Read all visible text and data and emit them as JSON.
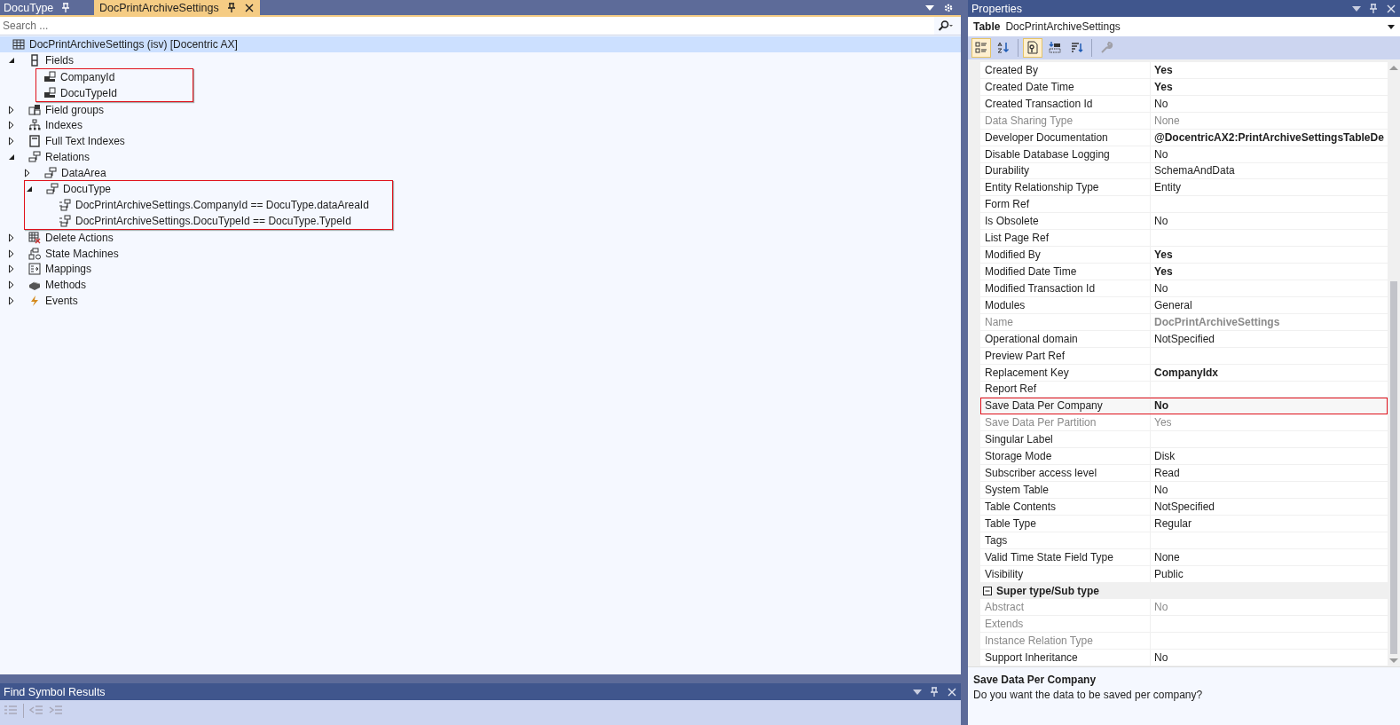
{
  "tabs": [
    {
      "label": "DocuType",
      "selected": false
    },
    {
      "label": "DocPrintArchiveSettings",
      "selected": true
    }
  ],
  "search": {
    "placeholder": "Search ..."
  },
  "tree": {
    "label": "DocPrintArchiveSettings (isv) [Docentric AX]",
    "kind": "table",
    "children": [
      {
        "label": "Fields",
        "kind": "fields",
        "expanded": true,
        "children_boxed": true,
        "children": [
          {
            "label": "CompanyId",
            "kind": "field"
          },
          {
            "label": "DocuTypeId",
            "kind": "field"
          }
        ]
      },
      {
        "label": "Field groups",
        "kind": "fieldgroup",
        "expanded": false
      },
      {
        "label": "Indexes",
        "kind": "index",
        "expanded": false
      },
      {
        "label": "Full Text Indexes",
        "kind": "fulltext",
        "expanded": false
      },
      {
        "label": "Relations",
        "kind": "relation",
        "expanded": true,
        "children": [
          {
            "label": "DataArea",
            "kind": "relation",
            "expanded": false
          },
          {
            "label": "DocuType",
            "kind": "relation",
            "expanded": true,
            "boxed": true,
            "children": [
              {
                "label": "DocPrintArchiveSettings.CompanyId == DocuType.dataAreaId",
                "kind": "constraint"
              },
              {
                "label": "DocPrintArchiveSettings.DocuTypeId == DocuType.TypeId",
                "kind": "constraint"
              }
            ]
          }
        ]
      },
      {
        "label": "Delete Actions",
        "kind": "delete",
        "expanded": false
      },
      {
        "label": "State Machines",
        "kind": "state",
        "expanded": false
      },
      {
        "label": "Mappings",
        "kind": "mapping",
        "expanded": false
      },
      {
        "label": "Methods",
        "kind": "method",
        "expanded": false
      },
      {
        "label": "Events",
        "kind": "event",
        "expanded": false
      }
    ]
  },
  "properties": {
    "title": "Properties",
    "object_type": "Table",
    "object_name": "DocPrintArchiveSettings",
    "toolbar": [
      {
        "kind": "categorized",
        "selected": true
      },
      {
        "kind": "alphabetical",
        "selected": false
      },
      {
        "kind": "properties",
        "selected": true
      },
      {
        "kind": "events",
        "selected": false
      },
      {
        "kind": "sort",
        "selected": false
      },
      {
        "kind": "wrench",
        "selected": false
      }
    ],
    "rows": [
      {
        "kind": "property",
        "name": "Created By",
        "value": "Yes",
        "bold": true,
        "disabled": false
      },
      {
        "kind": "property",
        "name": "Created Date Time",
        "value": "Yes",
        "bold": true,
        "disabled": false
      },
      {
        "kind": "property",
        "name": "Created Transaction Id",
        "value": "No",
        "bold": false,
        "disabled": false
      },
      {
        "kind": "property",
        "name": "Data Sharing Type",
        "value": "None",
        "bold": false,
        "disabled": true
      },
      {
        "kind": "property",
        "name": "Developer Documentation",
        "value": "@DocentricAX2:PrintArchiveSettingsTableDe",
        "bold": true,
        "disabled": false
      },
      {
        "kind": "property",
        "name": "Disable Database Logging",
        "value": "No",
        "bold": false,
        "disabled": false
      },
      {
        "kind": "property",
        "name": "Durability",
        "value": "SchemaAndData",
        "bold": false,
        "disabled": false
      },
      {
        "kind": "property",
        "name": "Entity Relationship Type",
        "value": "Entity",
        "bold": false,
        "disabled": false
      },
      {
        "kind": "property",
        "name": "Form Ref",
        "disabled": false
      },
      {
        "kind": "property",
        "name": "Is Obsolete",
        "value": "No",
        "bold": false,
        "disabled": false
      },
      {
        "kind": "property",
        "name": "List Page Ref",
        "disabled": false
      },
      {
        "kind": "property",
        "name": "Modified By",
        "value": "Yes",
        "bold": true,
        "disabled": false
      },
      {
        "kind": "property",
        "name": "Modified Date Time",
        "value": "Yes",
        "bold": true,
        "disabled": false
      },
      {
        "kind": "property",
        "name": "Modified Transaction Id",
        "value": "No",
        "bold": false,
        "disabled": false
      },
      {
        "kind": "property",
        "name": "Modules",
        "value": "General",
        "bold": false,
        "disabled": false
      },
      {
        "kind": "property",
        "name": "Name",
        "value": "DocPrintArchiveSettings",
        "bold": true,
        "disabled": true
      },
      {
        "kind": "property",
        "name": "Operational domain",
        "value": "NotSpecified",
        "bold": false,
        "disabled": false
      },
      {
        "kind": "property",
        "name": "Preview Part Ref",
        "disabled": false
      },
      {
        "kind": "property",
        "name": "Replacement Key",
        "value": "CompanyIdx",
        "bold": true,
        "disabled": false
      },
      {
        "kind": "property",
        "name": "Report Ref",
        "disabled": false
      },
      {
        "kind": "property",
        "name": "Save Data Per Company",
        "value": "No",
        "bold": true,
        "disabled": false,
        "boxed": true
      },
      {
        "kind": "property",
        "name": "Save Data Per Partition",
        "value": "Yes",
        "bold": false,
        "disabled": true
      },
      {
        "kind": "property",
        "name": "Singular Label",
        "disabled": false
      },
      {
        "kind": "property",
        "name": "Storage Mode",
        "value": "Disk",
        "bold": false,
        "disabled": false
      },
      {
        "kind": "property",
        "name": "Subscriber access level",
        "value": "Read",
        "bold": false,
        "disabled": false
      },
      {
        "kind": "property",
        "name": "System Table",
        "value": "No",
        "bold": false,
        "disabled": false
      },
      {
        "kind": "property",
        "name": "Table Contents",
        "value": "NotSpecified",
        "bold": false,
        "disabled": false
      },
      {
        "kind": "property",
        "name": "Table Type",
        "value": "Regular",
        "bold": false,
        "disabled": false
      },
      {
        "kind": "property",
        "name": "Tags",
        "disabled": false
      },
      {
        "kind": "property",
        "name": "Valid Time State Field Type",
        "value": "None",
        "bold": false,
        "disabled": false
      },
      {
        "kind": "property",
        "name": "Visibility",
        "value": "Public",
        "bold": false,
        "disabled": false
      },
      {
        "kind": "category",
        "name": "Super type/Sub type",
        "expanded": true
      },
      {
        "kind": "property",
        "name": "Abstract",
        "value": "No",
        "bold": false,
        "disabled": true
      },
      {
        "kind": "property",
        "name": "Extends",
        "disabled": true
      },
      {
        "kind": "property",
        "name": "Instance Relation Type",
        "disabled": true
      },
      {
        "kind": "property",
        "name": "Support Inheritance",
        "value": "No",
        "bold": false,
        "disabled": false
      }
    ],
    "description": {
      "title": "Save Data Per Company",
      "text": "Do you want the data to be saved per company?"
    }
  },
  "bottom_panel": {
    "title": "Find Symbol Results"
  }
}
